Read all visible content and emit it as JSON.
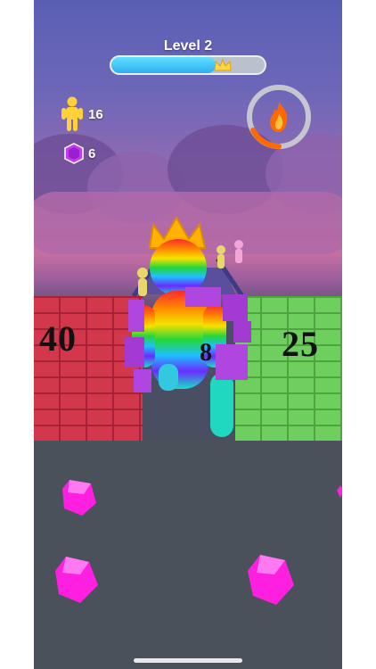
{
  "hud": {
    "level_label": "Level 2",
    "progress_fraction": 0.68,
    "progress_icon": "crown-icon",
    "crowd_count": "16",
    "gem_count": "6",
    "boost_icon": "fire-icon"
  },
  "walls": {
    "left_value": "40",
    "middle_value": "8",
    "right_value": "25"
  },
  "colors": {
    "progress": "#2eaef0",
    "wall_left": "#d2374b",
    "wall_right": "#6fcf5e",
    "gem": "#ff1fe0",
    "boost": "#ff6a00"
  }
}
